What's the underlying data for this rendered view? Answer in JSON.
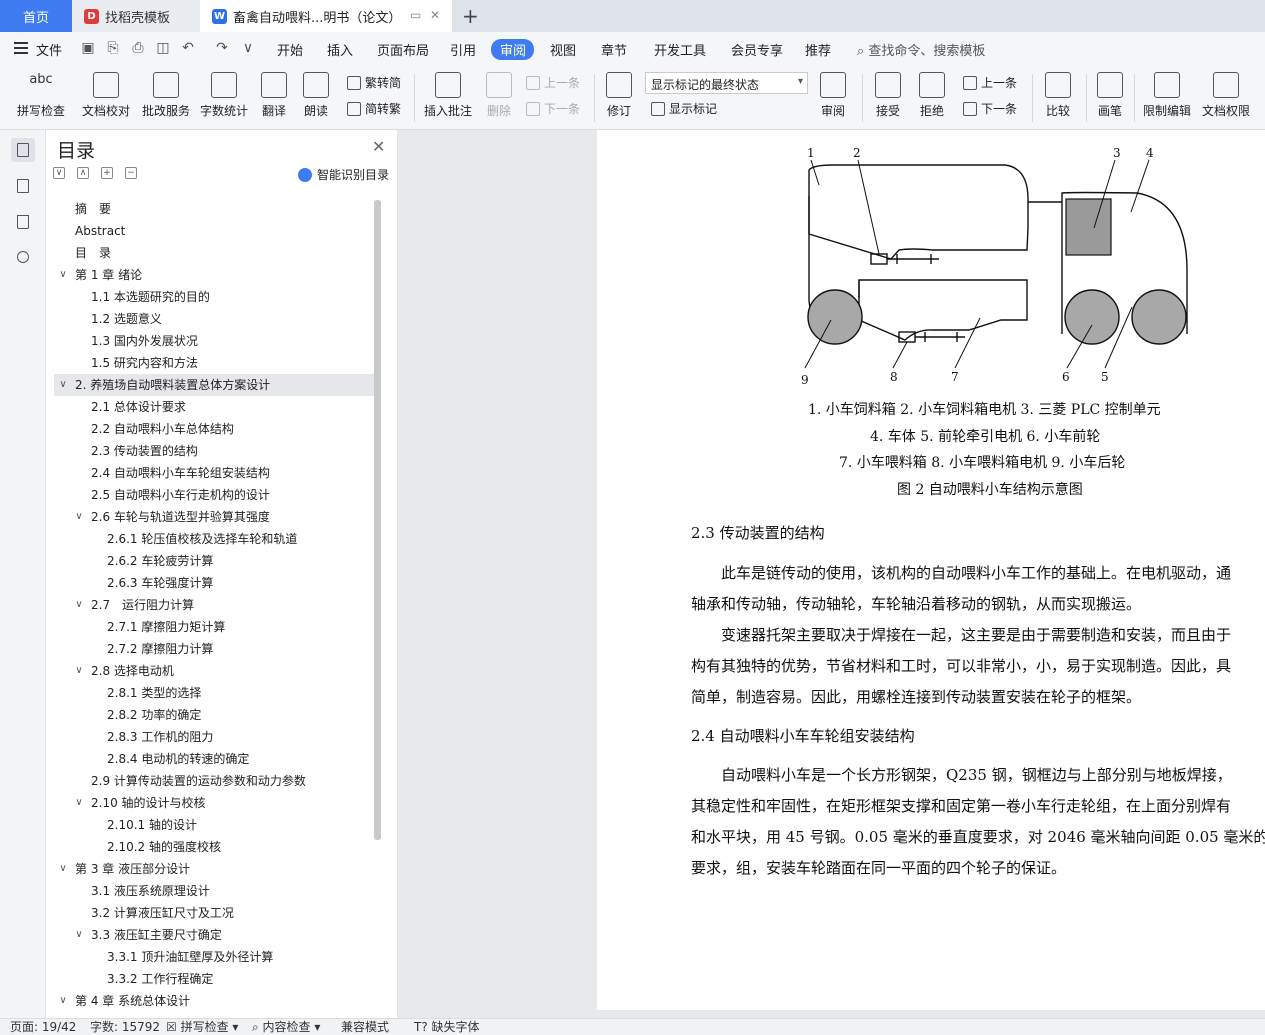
{
  "tabs": [
    {
      "label": "首页"
    },
    {
      "label": "找稻壳模板",
      "badge": "D"
    },
    {
      "label": "畜禽自动喂料...明书（论文）",
      "badge": "W"
    }
  ],
  "menubar": {
    "file": "文件",
    "items": [
      "开始",
      "插入",
      "页面布局",
      "引用",
      "审阅",
      "视图",
      "章节",
      "开发工具",
      "会员专享",
      "推荐"
    ],
    "active": "审阅",
    "search": "查找命令、搜索模板"
  },
  "ribbon": {
    "spell_check": "拼写检查",
    "spell_icon_text": "abc",
    "doc_proof": "文档校对",
    "batch_service": "批改服务",
    "word_count": "字数统计",
    "translate": "翻译",
    "read_aloud": "朗读",
    "trad_simp": "繁转简",
    "simp_trad": "简转繁",
    "insert_comment": "插入批注",
    "delete": "删除",
    "prev": "上一条",
    "next": "下一条",
    "revise": "修订",
    "markup_state": "显示标记的最终状态",
    "show_markup": "显示标记",
    "review": "审阅",
    "accept": "接受",
    "reject": "拒绝",
    "prev2": "上一条",
    "next2": "下一条",
    "compare": "比较",
    "pen": "画笔",
    "restrict": "限制编辑",
    "doc_rights": "文档权限"
  },
  "toc": {
    "title": "目录",
    "smart": "智能识别目录",
    "items": [
      {
        "text": "摘　要",
        "level": 0
      },
      {
        "text": "Abstract",
        "level": 0
      },
      {
        "text": "目　录",
        "level": 0
      },
      {
        "text": "第 1 章  绪论",
        "level": 0,
        "arrow": "∨"
      },
      {
        "text": "1.1 本选题研究的目的",
        "level": 1
      },
      {
        "text": "1.2 选题意义",
        "level": 1
      },
      {
        "text": "1.3 国内外发展状况",
        "level": 1
      },
      {
        "text": "1.5 研究内容和方法",
        "level": 1
      },
      {
        "text": "2.  养殖场自动喂料装置总体方案设计",
        "level": 0,
        "arrow": "∨",
        "active": true
      },
      {
        "text": "2.1  总体设计要求",
        "level": 1
      },
      {
        "text": "2.2  自动喂料小车总体结构",
        "level": 1
      },
      {
        "text": "2.3  传动装置的结构",
        "level": 1
      },
      {
        "text": "2.4  自动喂料小车车轮组安装结构",
        "level": 1
      },
      {
        "text": "2.5 自动喂料小车行走机构的设计",
        "level": 1
      },
      {
        "text": "2.6 车轮与轨道选型并验算其强度",
        "level": 1,
        "arrow": "∨"
      },
      {
        "text": "2.6.1 轮压值校核及选择车轮和轨道",
        "level": 2
      },
      {
        "text": "2.6.2 车轮疲劳计算",
        "level": 2
      },
      {
        "text": "2.6.3 车轮强度计算",
        "level": 2
      },
      {
        "text": "2.7　运行阻力计算",
        "level": 1,
        "arrow": "∨"
      },
      {
        "text": "2.7.1 摩擦阻力矩计算",
        "level": 2
      },
      {
        "text": "2.7.2 摩擦阻力计算",
        "level": 2
      },
      {
        "text": "2.8  选择电动机",
        "level": 1,
        "arrow": "∨"
      },
      {
        "text": "2.8.1 类型的选择",
        "level": 2
      },
      {
        "text": "2.8.2 功率的确定",
        "level": 2
      },
      {
        "text": "2.8.3 工作机的阻力",
        "level": 2
      },
      {
        "text": "2.8.4 电动机的转速的确定",
        "level": 2
      },
      {
        "text": "2.9 计算传动装置的运动参数和动力参数",
        "level": 1
      },
      {
        "text": "2.10 轴的设计与校核",
        "level": 1,
        "arrow": "∨"
      },
      {
        "text": "2.10.1 轴的设计",
        "level": 2
      },
      {
        "text": "2.10.2  轴的强度校核",
        "level": 2
      },
      {
        "text": "第 3 章  液压部分设计",
        "level": 0,
        "arrow": "∨"
      },
      {
        "text": "3.1  液压系统原理设计",
        "level": 1
      },
      {
        "text": "3.2 计算液压缸尺寸及工况",
        "level": 1
      },
      {
        "text": "3.3 液压缸主要尺寸确定",
        "level": 1,
        "arrow": "∨"
      },
      {
        "text": "3.3.1 顶升油缸壁厚及外径计算",
        "level": 2
      },
      {
        "text": "3.3.2 工作行程确定",
        "level": 2
      },
      {
        "text": "第 4 章  系统总体设计",
        "level": 0,
        "arrow": "∨"
      }
    ]
  },
  "document": {
    "figure_labels": [
      "1",
      "2",
      "3",
      "4",
      "5",
      "6",
      "7",
      "8",
      "9"
    ],
    "caption_lines": [
      "1. 小车饲料箱   2. 小车饲料箱电机   3. 三菱 PLC 控制单元",
      "4. 车体   5. 前轮牵引电机   6. 小车前轮",
      "7. 小车喂料箱   8. 小车喂料箱电机   9. 小车后轮",
      "图 2    自动喂料小车结构示意图"
    ],
    "sec_2_3": "2.3  传动装置的结构",
    "p1": [
      "　　此车是链传动的使用，该机构的自动喂料小车工作的基础上。在电机驱动，通",
      "轴承和传动轴，传动轴轮，车轮轴沿着移动的钢轨，从而实现搬运。"
    ],
    "p2": [
      "　　变速器托架主要取决于焊接在一起，这主要是由于需要制造和安装，而且由于",
      "构有其独特的优势，节省材料和工时，可以非常小，小，易于实现制造。因此，具",
      "简单，制造容易。因此，用螺栓连接到传动装置安装在轮子的框架。"
    ],
    "sec_2_4": "2.4  自动喂料小车车轮组安装结构",
    "p3": [
      "　　自动喂料小车是一个长方形钢架，Q235 钢，钢框边与上部分别与地板焊接，",
      "其稳定性和牢固性，在矩形框架支撑和固定第一卷小车行走轮组，在上面分别焊有",
      "和水平块，用 45 号钢。0.05 毫米的垂直度要求，对 2046 毫米轴向间距 0.05 毫米的",
      "要求，组，安装车轮踏面在同一平面的四个轮子的保证。"
    ]
  },
  "status": {
    "page": "页面: 19/42",
    "words": "字数: 15792",
    "spell": "拼写检查",
    "content": "内容检查",
    "compat": "兼容模式",
    "font": "缺失字体"
  }
}
